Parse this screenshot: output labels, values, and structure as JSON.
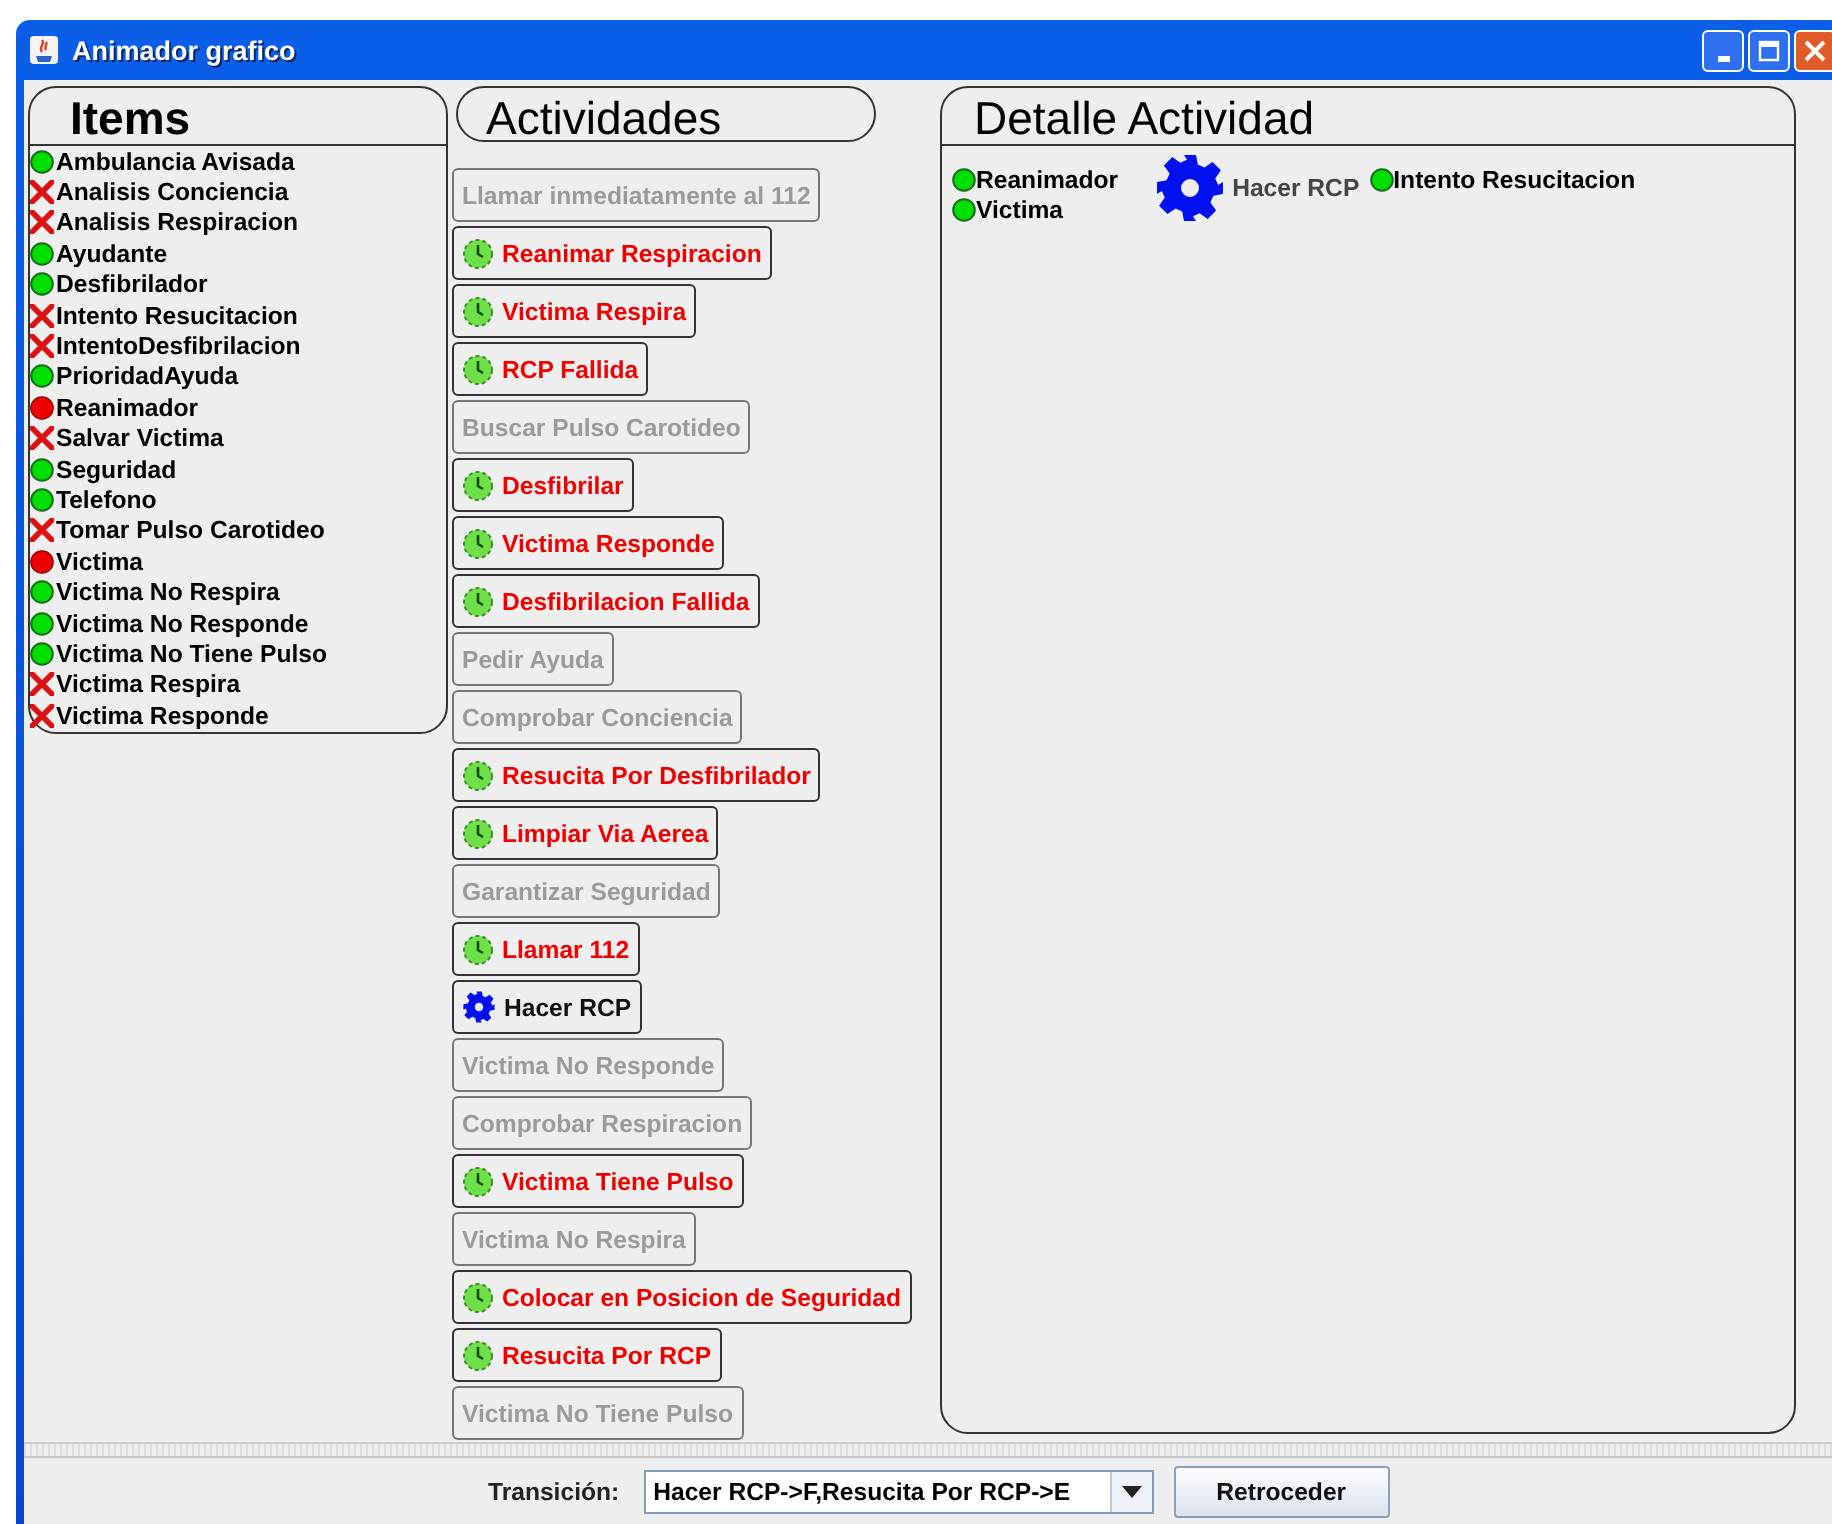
{
  "window": {
    "title": "Animador grafico"
  },
  "items": {
    "title": "Items",
    "list": [
      {
        "label": "Ambulancia Avisada",
        "kind": "ok"
      },
      {
        "label": "Analisis Conciencia",
        "kind": "cross"
      },
      {
        "label": "Analisis Respiracion",
        "kind": "cross"
      },
      {
        "label": "Ayudante",
        "kind": "ok"
      },
      {
        "label": "Desfibrilador",
        "kind": "ok"
      },
      {
        "label": "Intento Resucitacion",
        "kind": "cross"
      },
      {
        "label": "IntentoDesfibrilacion",
        "kind": "cross"
      },
      {
        "label": "PrioridadAyuda",
        "kind": "ok"
      },
      {
        "label": "Reanimador",
        "kind": "busy"
      },
      {
        "label": "Salvar Victima",
        "kind": "cross"
      },
      {
        "label": "Seguridad",
        "kind": "ok"
      },
      {
        "label": "Telefono",
        "kind": "ok"
      },
      {
        "label": "Tomar Pulso Carotideo",
        "kind": "cross"
      },
      {
        "label": "Victima",
        "kind": "busy"
      },
      {
        "label": "Victima No Respira",
        "kind": "ok"
      },
      {
        "label": "Victima No Responde",
        "kind": "ok"
      },
      {
        "label": "Victima No Tiene Pulso",
        "kind": "ok"
      },
      {
        "label": "Victima Respira",
        "kind": "cross"
      },
      {
        "label": "Victima Responde",
        "kind": "cross"
      }
    ]
  },
  "activities": {
    "title": "Actividades",
    "list": [
      {
        "label": "Llamar inmediatamente al 112",
        "kind": "disabled"
      },
      {
        "label": "Reanimar Respiracion",
        "kind": "ready"
      },
      {
        "label": "Victima Respira",
        "kind": "ready"
      },
      {
        "label": "RCP Fallida",
        "kind": "ready"
      },
      {
        "label": "Buscar Pulso Carotideo",
        "kind": "disabled"
      },
      {
        "label": "Desfibrilar",
        "kind": "ready"
      },
      {
        "label": "Victima Responde",
        "kind": "ready"
      },
      {
        "label": "Desfibrilacion Fallida",
        "kind": "ready"
      },
      {
        "label": "Pedir Ayuda",
        "kind": "disabled"
      },
      {
        "label": "Comprobar Conciencia",
        "kind": "disabled"
      },
      {
        "label": "Resucita Por Desfibrilador",
        "kind": "ready"
      },
      {
        "label": "Limpiar Via Aerea",
        "kind": "ready"
      },
      {
        "label": "Garantizar Seguridad",
        "kind": "disabled"
      },
      {
        "label": "Llamar 112",
        "kind": "ready"
      },
      {
        "label": "Hacer RCP",
        "kind": "running"
      },
      {
        "label": "Victima No Responde",
        "kind": "disabled"
      },
      {
        "label": "Comprobar Respiracion",
        "kind": "disabled"
      },
      {
        "label": "Victima Tiene Pulso",
        "kind": "ready"
      },
      {
        "label": "Victima No Respira",
        "kind": "disabled"
      },
      {
        "label": "Colocar en Posicion de Seguridad",
        "kind": "ready"
      },
      {
        "label": "Resucita Por RCP",
        "kind": "ready"
      },
      {
        "label": "Victima No Tiene Pulso",
        "kind": "disabled"
      }
    ]
  },
  "detail": {
    "title": "Detalle Actividad",
    "inputs": [
      {
        "label": "Reanimador",
        "kind": "ok"
      },
      {
        "label": "Victima",
        "kind": "ok"
      }
    ],
    "activity": "Hacer RCP",
    "outputs": [
      {
        "label": "Intento Resucitacion",
        "kind": "ok"
      }
    ]
  },
  "bottom": {
    "label": "Transición:",
    "transition": "Hacer RCP->F,Resucita Por RCP->E",
    "button": "Retroceder"
  }
}
